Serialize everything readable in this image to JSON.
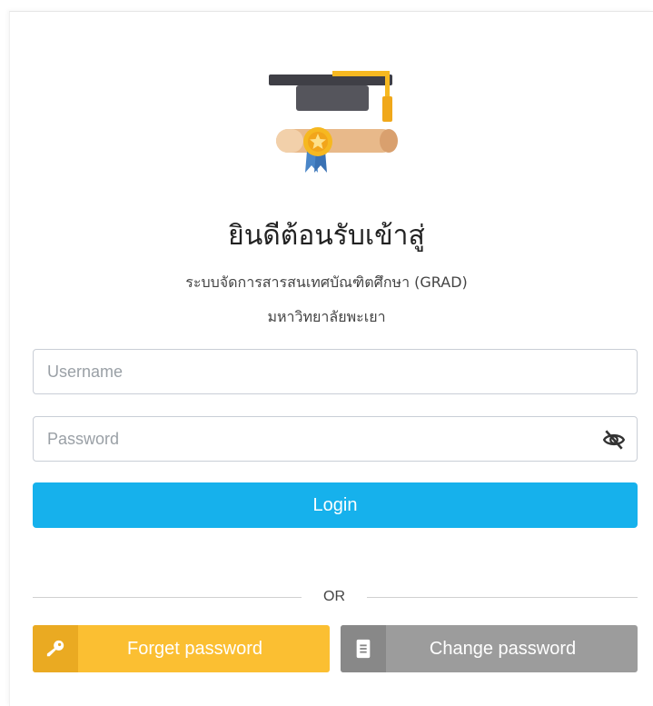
{
  "header": {
    "title": "ยินดีต้อนรับเข้าสู่",
    "subtitle": "ระบบจัดการสารสนเทศบัณฑิตศึกษา (GRAD)",
    "institution": "มหาวิทยาลัยพะเยา"
  },
  "form": {
    "username_placeholder": "Username",
    "username_value": "",
    "password_placeholder": "Password",
    "password_value": "",
    "login_label": "Login"
  },
  "divider": {
    "text": "OR"
  },
  "actions": {
    "forget_label": "Forget password",
    "change_label": "Change password"
  },
  "icons": {
    "logo": "graduation-cap-diploma-icon",
    "password_toggle": "eye-slash-icon",
    "forget": "key-icon",
    "change": "document-icon"
  },
  "colors": {
    "login": "#16b1ec",
    "forget": "#fbbf32",
    "change": "#9c9c9c"
  }
}
